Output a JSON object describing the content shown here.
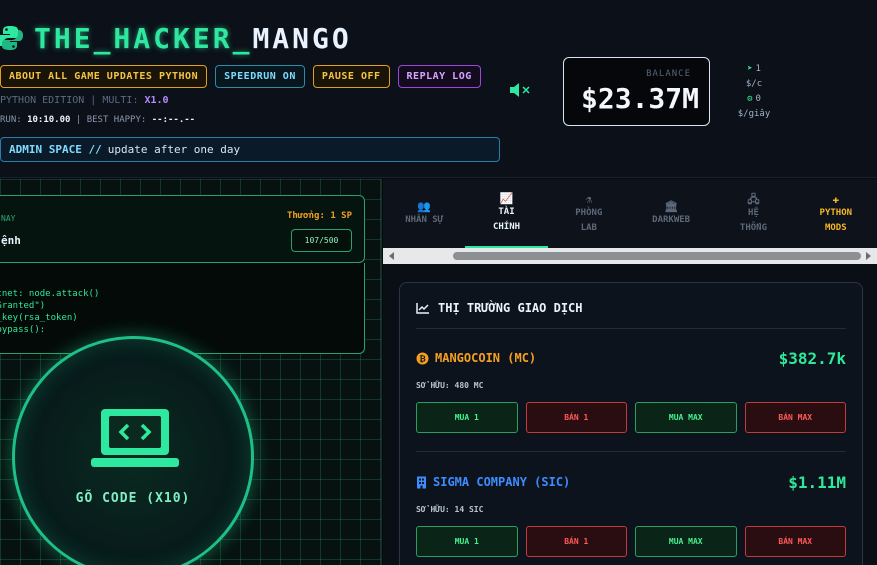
{
  "header": {
    "logo_a": "THE_HACKER_",
    "logo_b": "MANGO",
    "buttons": [
      "ABOUT ALL GAME UPDATES PYTHON",
      "SPEEDRUN ON",
      "PAUSE OFF",
      "REPLAY LOG"
    ],
    "edition": "PYTHON EDITION | MULTI: ",
    "multi": "X1.0",
    "run_label": "RUN: ",
    "run_time": "10:10.00",
    "best_label": " | BEST HAPPY: ",
    "best_time": "--:--.--",
    "admin_title": "ADMIN SPACE //",
    "admin_msg": "update after one day"
  },
  "balance": {
    "label": "BALANCE",
    "value": "$23.37M"
  },
  "rates": {
    "click_value": "1",
    "click_unit": "$/c",
    "sec_value": "0",
    "sec_unit": "$/giây"
  },
  "task": {
    "header": "NAY",
    "name": "ệnh",
    "reward": "Thưởng: 1 SP",
    "progress": "107/500"
  },
  "code_lines": [
    "otnet: node.attack()",
    " Granted\")",
    "t_key(rsa_token)",
    "",
    "_bypass():"
  ],
  "hack_button": {
    "label": "GÕ CODE (X10)"
  },
  "tabs": [
    {
      "icon": "👥",
      "l1": "NHÂN SỰ",
      "l2": ""
    },
    {
      "icon": "📈",
      "l1": "TÀI",
      "l2": "CHÍNH"
    },
    {
      "icon": "⚗",
      "l1": "PHÒNG",
      "l2": "LAB"
    },
    {
      "icon": "🏛",
      "l1": "DARKWEB",
      "l2": ""
    },
    {
      "icon": "🖧",
      "l1": "HỆ",
      "l2": "THỐNG"
    },
    {
      "icon": "✚",
      "l1": "PYTHON",
      "l2": "MODS"
    }
  ],
  "market": {
    "title": "THỊ TRƯỜNG GIAO DỊCH",
    "assets": [
      {
        "name": "MANGOCOIN (MC)",
        "price": "$382.7k",
        "owned": "SỞ HỮU: 480 MC",
        "color": "#f6a020"
      },
      {
        "name": "SIGMA COMPANY (SIC)",
        "price": "$1.11M",
        "owned": "SỞ HỮU: 14 SIC",
        "color": "#3d8cff"
      }
    ],
    "buy1": "MUA 1",
    "sell1": "BÁN 1",
    "buymax": "MUA MAX",
    "sellmax": "BÁN MAX"
  }
}
